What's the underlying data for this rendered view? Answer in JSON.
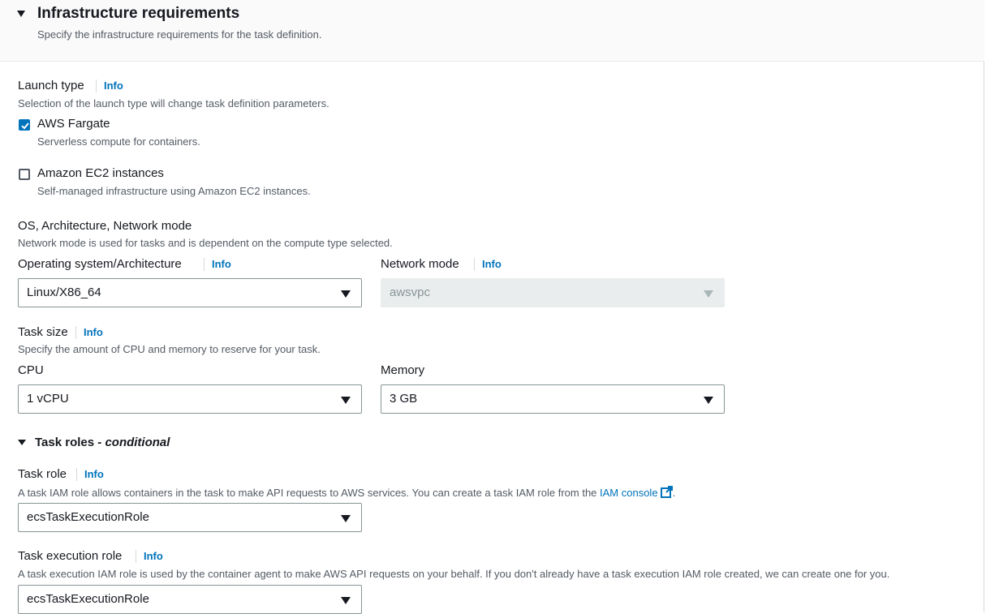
{
  "section": {
    "title": "Infrastructure requirements",
    "description": "Specify the infrastructure requirements for the task definition."
  },
  "launch_type": {
    "label": "Launch type",
    "info": "Info",
    "description": "Selection of the launch type will change task definition parameters.",
    "options": [
      {
        "label": "AWS Fargate",
        "description": "Serverless compute for containers.",
        "checked": true
      },
      {
        "label": "Amazon EC2 instances",
        "description": "Self-managed infrastructure using Amazon EC2 instances.",
        "checked": false
      }
    ]
  },
  "os_network": {
    "label": "OS, Architecture, Network mode",
    "description": "Network mode is used for tasks and is dependent on the compute type selected.",
    "os_arch": {
      "label": "Operating system/Architecture",
      "info": "Info",
      "value": "Linux/X86_64"
    },
    "network_mode": {
      "label": "Network mode",
      "info": "Info",
      "value": "awsvpc",
      "disabled": true
    }
  },
  "task_size": {
    "label": "Task size",
    "info": "Info",
    "description": "Specify the amount of CPU and memory to reserve for your task.",
    "cpu": {
      "label": "CPU",
      "value": "1 vCPU"
    },
    "memory": {
      "label": "Memory",
      "value": "3 GB"
    }
  },
  "task_roles": {
    "title": "Task roles - ",
    "title_emphasis": "conditional",
    "task_role": {
      "label": "Task role",
      "info": "Info",
      "description_pre": "A task IAM role allows containers in the task to make API requests to AWS services. You can create a task IAM role from the ",
      "link": "IAM console",
      "description_post": ".",
      "value": "ecsTaskExecutionRole"
    },
    "execution_role": {
      "label": "Task execution role",
      "info": "Info",
      "description": "A task execution IAM role is used by the container agent to make AWS API requests on your behalf. If you don't already have a task execution IAM role created, we can create one for you.",
      "value": "ecsTaskExecutionRole"
    }
  },
  "colors": {
    "accent": "#0073bb",
    "text": "#16191f",
    "muted": "#545b64",
    "disabled_bg": "#eaeded"
  }
}
